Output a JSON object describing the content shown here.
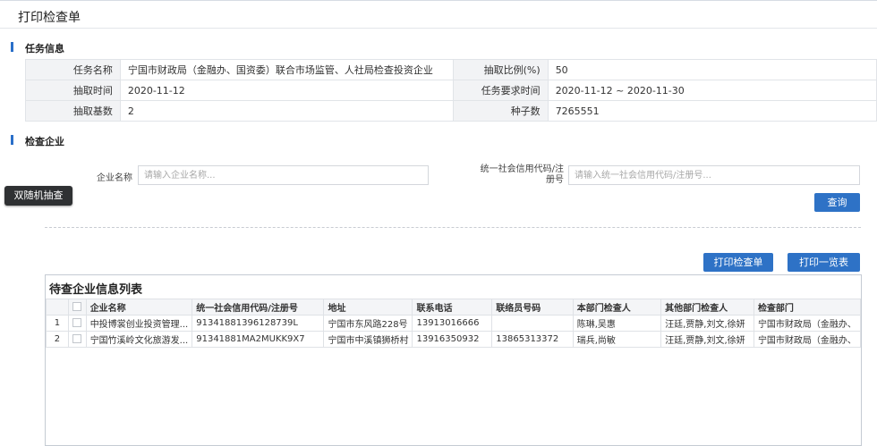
{
  "page": {
    "title": "打印检查单"
  },
  "task_section": {
    "title": "任务信息",
    "rows": [
      {
        "label1": "任务名称",
        "value1": "宁国市财政局（金融办、国资委）联合市场监管、人社局检查投资企业",
        "label2": "抽取比例(%)",
        "value2": "50"
      },
      {
        "label1": "抽取时间",
        "value1": "2020-11-12",
        "label2": "任务要求时间",
        "value2": "2020-11-12 ~ 2020-11-30"
      },
      {
        "label1": "抽取基数",
        "value1": "2",
        "label2": "种子数",
        "value2": "7265551"
      }
    ]
  },
  "enterprise_section": {
    "title": "检查企业",
    "name_label": "企业名称",
    "name_placeholder": "请输入企业名称...",
    "code_label": "统一社会信用代码/注册号",
    "code_placeholder": "请输入统一社会信用代码/注册号...",
    "search_button": "查询"
  },
  "side_tag": {
    "label": "双随机抽查"
  },
  "actions": {
    "print_check": "打印检查单",
    "print_list": "打印一览表"
  },
  "grid": {
    "title": "待查企业信息列表",
    "columns": [
      "企业名称",
      "统一社会信用代码/注册号",
      "地址",
      "联系电话",
      "联络员号码",
      "本部门检查人",
      "其他部门检查人",
      "检查部门"
    ],
    "rows": [
      {
        "index": "1",
        "name": "中投博裳创业投资管理...",
        "code": "91341881396128739L",
        "address": "宁国市东风路228号",
        "phone": "13913016666",
        "liaison": "",
        "inspectors": "陈琳,吴惠",
        "other_inspectors": "汪廷,贾静,刘文,徐妍",
        "department": "宁国市财政局（金融办、"
      },
      {
        "index": "2",
        "name": "宁国竹溪岭文化旅游发...",
        "code": "91341881MA2MUKK9X7",
        "address": "宁国市中溪镇狮桥村",
        "phone": "13916350932",
        "liaison": "13865313372",
        "inspectors": "瑞兵,尚敏",
        "other_inspectors": "汪廷,贾静,刘文,徐妍",
        "department": "宁国市财政局（金融办、"
      }
    ]
  }
}
